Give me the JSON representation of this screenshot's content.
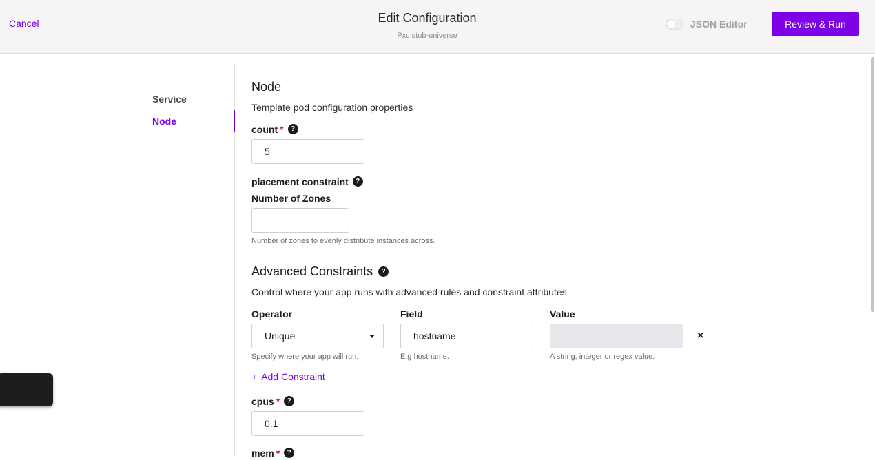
{
  "header": {
    "cancel_label": "Cancel",
    "title": "Edit Configuration",
    "subtitle": "Pxc stub-universe",
    "json_editor_label": "JSON Editor",
    "json_editor_enabled": false,
    "review_button_label": "Review & Run"
  },
  "sidebar": {
    "items": [
      {
        "label": "Service",
        "active": false
      },
      {
        "label": "Node",
        "active": true
      }
    ]
  },
  "node_section": {
    "title": "Node",
    "description": "Template pod configuration properties",
    "count": {
      "label": "count",
      "required_mark": "*",
      "value": "5"
    },
    "placement": {
      "label": "placement constraint",
      "zones_label": "Number of Zones",
      "zones_value": "",
      "zones_hint": "Number of zones to evenly distribute instances across."
    }
  },
  "advanced": {
    "title": "Advanced Constraints",
    "description": "Control where your app runs with advanced rules and constraint attributes",
    "columns": {
      "operator": "Operator",
      "field": "Field",
      "value": "Value"
    },
    "row": {
      "operator": "Unique",
      "field": "hostname",
      "value": "",
      "operator_hint": "Specify where your app will run.",
      "field_hint": "E.g hostname.",
      "value_hint": "A string, integer or regex value."
    },
    "remove_icon": "×",
    "add_label": "Add Constraint",
    "add_icon": "+"
  },
  "cpus": {
    "label": "cpus",
    "required_mark": "*",
    "value": "0.1"
  },
  "mem": {
    "label": "mem",
    "required_mark": "*"
  },
  "help_icon_glyph": "?",
  "colors": {
    "accent": "#7d00e6",
    "required": "#e0132f"
  }
}
